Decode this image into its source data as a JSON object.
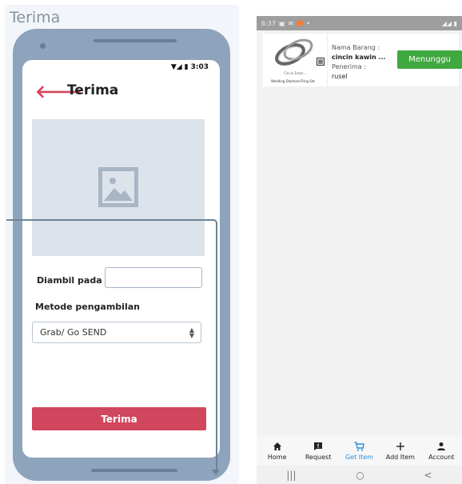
{
  "wireframe": {
    "title": "Terima",
    "status_time": "3:03",
    "screen_title": "Terima",
    "diambil_label": "Diambil pada :",
    "metode_label": "Metode pengambilan",
    "metode_selected": "Grab/ Go SEND",
    "submit_label": "Terima"
  },
  "app": {
    "status_time": "6:37",
    "item": {
      "nama_label": "Nama Barang :",
      "nama_value": "cincin kawin ...",
      "penerima_label": "Penerima :",
      "penerima_value": "rusel",
      "status_label": "Menunggu",
      "thumb_caption_small": "Cincin Emas ... ",
      "thumb_caption": "Wedding Diamond Ring Set"
    },
    "nav": [
      {
        "label": "Home",
        "icon": "home-icon"
      },
      {
        "label": "Request",
        "icon": "request-icon"
      },
      {
        "label": "Get Item",
        "icon": "cart-icon"
      },
      {
        "label": "Add Item",
        "icon": "plus-icon"
      },
      {
        "label": "Account",
        "icon": "account-icon"
      }
    ],
    "system_nav": [
      "|||",
      "○",
      "<"
    ]
  },
  "colors": {
    "accent_red": "#d0465c",
    "active_blue": "#2b8edb",
    "status_green": "#3fa83f",
    "wire_frame": "#8ea4bd"
  }
}
